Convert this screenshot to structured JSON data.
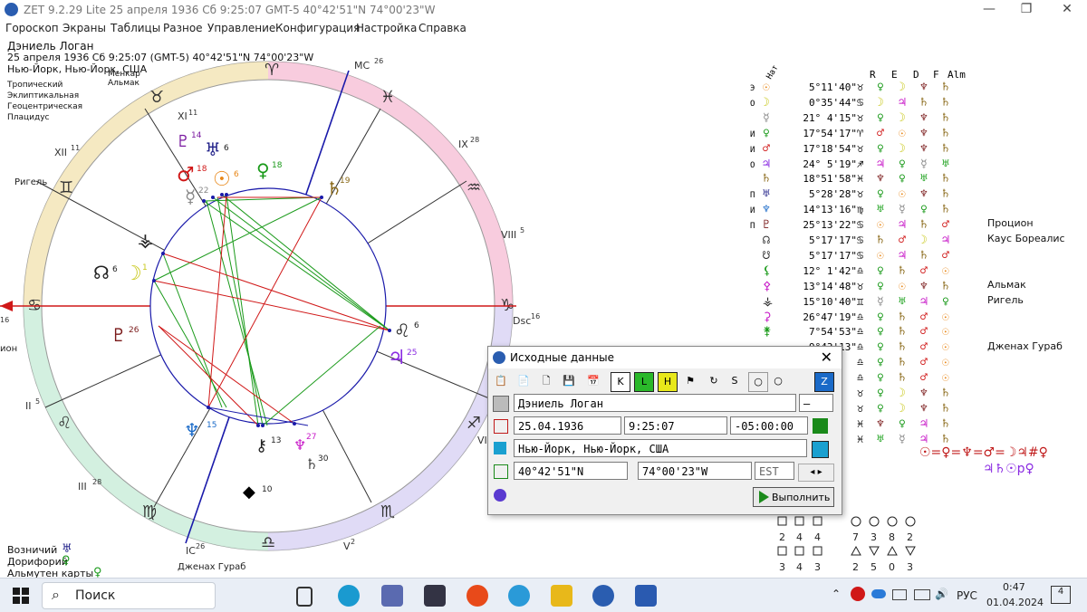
{
  "window": {
    "title": "ZET 9.2.29 Lite    25 апреля 1936  Сб   9:25:07 GMT-5 40°42'51\"N  74°00'23\"W",
    "minimize": "—",
    "maximize": "❐",
    "close": "✕"
  },
  "menu": [
    "Гороскоп",
    "Экраны",
    "Таблицы",
    "Разное",
    "Управление",
    "Конфигурация",
    "Настройка",
    "Справка"
  ],
  "info": {
    "name": "Дэниель Логан",
    "datetime": "25 апреля 1936  Сб   9:25:07 (GMT-5) 40°42'51\"N  74°00'23\"W",
    "place": "Нью-Йорк, Нью-Йорк, США",
    "settings": [
      "Тропический",
      "Эклиптикальная",
      "Геоцентрическая",
      "Плацидус"
    ],
    "star_top1": "Менкар",
    "star_top2": "Альмак",
    "star_rigel": "Ригель",
    "star_left": "ион",
    "star_bottom": "Дженах Гураб"
  },
  "houses": {
    "mc": "MC",
    "mc_deg": "26",
    "xi": "XI",
    "xi_deg": "11",
    "xii": "XII",
    "xii_deg": "11",
    "ix": "IX",
    "ix_deg": "28",
    "viii": "VIII",
    "viii_deg": "5",
    "dsc": "Dsc",
    "dsc_deg": "16",
    "asc_deg": "16",
    "ii": "II",
    "ii_deg": "5",
    "iii": "III",
    "iii_deg": "28",
    "ic": "IC",
    "ic_deg": "26",
    "v": "V",
    "v_deg": "2",
    "vi": "VI"
  },
  "chart_planets": [
    {
      "glyph": "♅",
      "deg": "6",
      "color": "#23238a"
    },
    {
      "glyph": "♂",
      "deg": "18",
      "color": "#d01818"
    },
    {
      "glyph": "☉",
      "deg": "6",
      "color": "#e8881a"
    },
    {
      "glyph": "♀",
      "deg": "18",
      "color": "#1a9a1a"
    },
    {
      "glyph": "☿",
      "deg": "22",
      "color": "#888888"
    },
    {
      "glyph": "♄",
      "deg": "19",
      "color": "#8a6a1a"
    },
    {
      "glyph": "♇",
      "deg": "14",
      "color": "#7a1aa0"
    },
    {
      "glyph": "☊",
      "deg": "6",
      "color": "#222222"
    },
    {
      "glyph": "☽",
      "deg": "1",
      "color": "#c8c81a"
    },
    {
      "glyph": "♇",
      "deg": "26",
      "color": "#7a1a1a"
    },
    {
      "glyph": "♌",
      "deg": "6",
      "color": "#222222"
    },
    {
      "glyph": "♃",
      "deg": "25",
      "color": "#8a2be2"
    },
    {
      "glyph": "♆",
      "deg": "15",
      "color": "#1a6ac8"
    },
    {
      "glyph": "⚷",
      "deg": "13",
      "color": "#222222"
    },
    {
      "glyph": "♆",
      "deg": "27",
      "color": "#c81ac8"
    },
    {
      "glyph": "◆",
      "deg": "10",
      "color": "#000000"
    },
    {
      "glyph": "♄",
      "deg": "30",
      "color": "#444444"
    }
  ],
  "table": {
    "headers": [
      "Нат",
      "R",
      "E",
      "D",
      "F",
      "Alm"
    ],
    "rows": [
      {
        "pre": "Э",
        "p": "☉",
        "pc": "#e8881a",
        "pos": " 5°11'40\"",
        "sign": "♉",
        "r": "♀",
        "e": "☽",
        "d": "♆",
        "f": "♄"
      },
      {
        "pre": "О",
        "p": "☽",
        "pc": "#c8c81a",
        "pos": " 0°35'44\"",
        "sign": "♋",
        "r": "☽",
        "e": "♃",
        "d": "♄",
        "f": "♄"
      },
      {
        "pre": "",
        "p": "☿",
        "pc": "#888888",
        "pos": "21° 4'15\"",
        "sign": "♉",
        "r": "♀",
        "e": "☽",
        "d": "♆",
        "f": "♄"
      },
      {
        "pre": "И",
        "p": "♀",
        "pc": "#1a9a1a",
        "pos": "17°54'17\"",
        "sign": "♈",
        "r": "♂",
        "e": "☉",
        "d": "♆",
        "f": "♄"
      },
      {
        "pre": "И",
        "p": "♂",
        "pc": "#d01818",
        "pos": "17°18'54\"",
        "sign": "♉",
        "r": "♀",
        "e": "☽",
        "d": "♆",
        "f": "♄"
      },
      {
        "pre": "О",
        "p": "♃",
        "pc": "#8a2be2",
        "pos": "24° 5'19\"",
        "sign": "♐",
        "r": "♃",
        "e": "♀",
        "d": "☿",
        "f": "♅"
      },
      {
        "pre": "",
        "p": "♄",
        "pc": "#8a6a1a",
        "pos": "18°51'58\"",
        "sign": "♓",
        "r": "♆",
        "e": "♀",
        "d": "♅",
        "f": "♄"
      },
      {
        "pre": "П",
        "p": "♅",
        "pc": "#23238a",
        "pos": " 5°28'28\"",
        "sign": "♉",
        "r": "♀",
        "e": "☉",
        "d": "♆",
        "f": "♄"
      },
      {
        "pre": "И",
        "p": "♆",
        "pc": "#1a6ac8",
        "pos": "14°13'16\"",
        "sign": "♍",
        "r": "♅",
        "e": "☿",
        "d": "♀",
        "f": "♄"
      },
      {
        "pre": "П",
        "p": "♇",
        "pc": "#7a1a1a",
        "pos": "25°13'22\"",
        "sign": "♋",
        "r": "☉",
        "e": "♃",
        "d": "♄",
        "f": "♂"
      },
      {
        "pre": "",
        "p": "☊",
        "pc": "#222222",
        "pos": " 5°17'17\"",
        "sign": "♋",
        "r": "♄",
        "e": "♂",
        "d": "☽",
        "f": "♃"
      },
      {
        "pre": "",
        "p": "☋",
        "pc": "#222222",
        "pos": " 5°17'17\"",
        "sign": "♋",
        "r": "☉",
        "e": "♃",
        "d": "♄",
        "f": "♂"
      },
      {
        "pre": "",
        "p": "⚸",
        "pc": "#1a9a1a",
        "pos": "12° 1'42\"",
        "sign": "♎",
        "r": "♀",
        "e": "♄",
        "d": "♂",
        "f": "☉"
      },
      {
        "pre": "",
        "p": "⚴",
        "pc": "#c81ac8",
        "pos": "13°14'48\"",
        "sign": "♉",
        "r": "♀",
        "e": "☉",
        "d": "♆",
        "f": "♄"
      },
      {
        "pre": "",
        "p": "⚶",
        "pc": "#222222",
        "pos": "15°10'40\"",
        "sign": "♊",
        "r": "☿",
        "e": "♅",
        "d": "♃",
        "f": "♀"
      },
      {
        "pre": "",
        "p": "⚳",
        "pc": "#c81ac8",
        "pos": "26°47'19\"",
        "sign": "♎",
        "r": "♀",
        "e": "♄",
        "d": "♂",
        "f": "☉"
      },
      {
        "pre": "",
        "p": "⚵",
        "pc": "#1a9a1a",
        "pos": " 7°54'53\"",
        "sign": "♎",
        "r": "♀",
        "e": "♄",
        "d": "♂",
        "f": "☉"
      },
      {
        "pre": "",
        "p": "",
        "pc": "#000000",
        "pos": " 9°43'13\"",
        "sign": "♎",
        "r": "♀",
        "e": "♄",
        "d": "♂",
        "f": "☉"
      },
      {
        "pre": "",
        "p": "",
        "pc": "#222222",
        "pos": "",
        "sign": "♎",
        "r": "♀",
        "e": "♄",
        "d": "♂",
        "f": "☉"
      },
      {
        "pre": "",
        "p": "",
        "pc": "#222222",
        "pos": "",
        "sign": "♎",
        "r": "♀",
        "e": "♄",
        "d": "♂",
        "f": "☉"
      },
      {
        "pre": "",
        "p": "",
        "pc": "#222222",
        "pos": "",
        "sign": "♉",
        "r": "♀",
        "e": "☽",
        "d": "♆",
        "f": "♄"
      },
      {
        "pre": "",
        "p": "",
        "pc": "#222222",
        "pos": "",
        "sign": "♉",
        "r": "♀",
        "e": "☽",
        "d": "♆",
        "f": "♄"
      },
      {
        "pre": "",
        "p": "",
        "pc": "#222222",
        "pos": "",
        "sign": "♓",
        "r": "♆",
        "e": "♀",
        "d": "♃",
        "f": "♄"
      },
      {
        "pre": "",
        "p": "",
        "pc": "#222222",
        "pos": "",
        "sign": "♓",
        "r": "♅",
        "e": "☿",
        "d": "♃",
        "f": "♄"
      }
    ]
  },
  "fixed_stars": [
    "Процион",
    "Каус Бореалис",
    "Альмак",
    "Ригель",
    "Дженах Гураб"
  ],
  "formula_line1": "☉=♀=♆=♂=☽♃#♀",
  "formula_line2": "♃♄☉р♀",
  "element_counts": {
    "row1": [
      "2",
      "4",
      "4",
      "7",
      "3",
      "8",
      "2"
    ],
    "row2": [
      "3",
      "4",
      "3",
      "2",
      "5",
      "0",
      "3"
    ]
  },
  "bottom_left": {
    "lord": "Возничий",
    "doryphory": "Дорифорий",
    "almuten": "Альмутен карты"
  },
  "dialog": {
    "title": "Исходные данные",
    "name": "Дэниель Логан",
    "sex": "—",
    "date": "25.04.1936",
    "time": "9:25:07",
    "zone": "-05:00:00",
    "place": "Нью-Йорк, Нью-Йорк, США",
    "lat": "40°42'51\"N",
    "lon": "74°00'23\"W",
    "tz_abbr": "EST",
    "run": "Выполнить",
    "toolbar": [
      "📋",
      "📄",
      "🗋",
      "💾",
      "📅",
      "K",
      "L",
      "H",
      "⚑",
      "↻",
      "S",
      "○",
      "○",
      "Z"
    ]
  },
  "taskbar": {
    "search": "Поиск",
    "lang": "РУС",
    "time": "0:47",
    "date": "01.04.2024",
    "notifications": "4"
  }
}
